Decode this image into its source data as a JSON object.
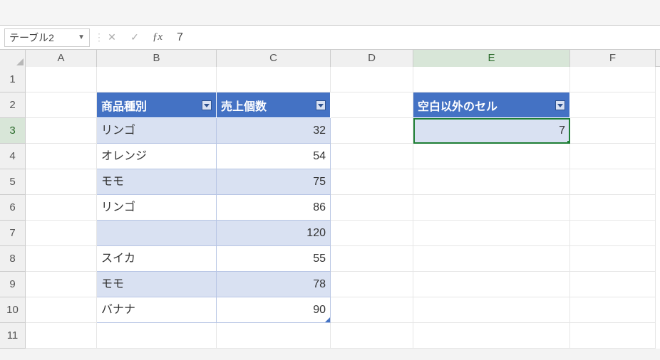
{
  "name_box": "テーブル2",
  "formula_value": "7",
  "columns": [
    "A",
    "B",
    "C",
    "D",
    "E",
    "F"
  ],
  "active_col": "E",
  "active_row": 3,
  "chart_data": {
    "type": "table",
    "title": "",
    "headers_main": [
      "商品種別",
      "売上個数"
    ],
    "rows_main": [
      {
        "商品種別": "リンゴ",
        "売上個数": 32
      },
      {
        "商品種別": "オレンジ",
        "売上個数": 54
      },
      {
        "商品種別": "モモ",
        "売上個数": 75
      },
      {
        "商品種別": "リンゴ",
        "売上個数": 86
      },
      {
        "商品種別": "",
        "売上個数": 120
      },
      {
        "商品種別": "スイカ",
        "売上個数": 55
      },
      {
        "商品種別": "モモ",
        "売上個数": 78
      },
      {
        "商品種別": "バナナ",
        "売上個数": 90
      }
    ],
    "headers_side": [
      "空白以外のセル"
    ],
    "rows_side": [
      {
        "空白以外のセル": 7
      }
    ]
  },
  "table_main": {
    "headers": {
      "b": "商品種別",
      "c": "売上個数"
    },
    "rows": [
      {
        "b": "リンゴ",
        "c": "32"
      },
      {
        "b": "オレンジ",
        "c": "54"
      },
      {
        "b": "モモ",
        "c": "75"
      },
      {
        "b": "リンゴ",
        "c": "86"
      },
      {
        "b": "",
        "c": "120"
      },
      {
        "b": "スイカ",
        "c": "55"
      },
      {
        "b": "モモ",
        "c": "78"
      },
      {
        "b": "バナナ",
        "c": "90"
      }
    ]
  },
  "table_side": {
    "header": "空白以外のセル",
    "value": "7"
  }
}
